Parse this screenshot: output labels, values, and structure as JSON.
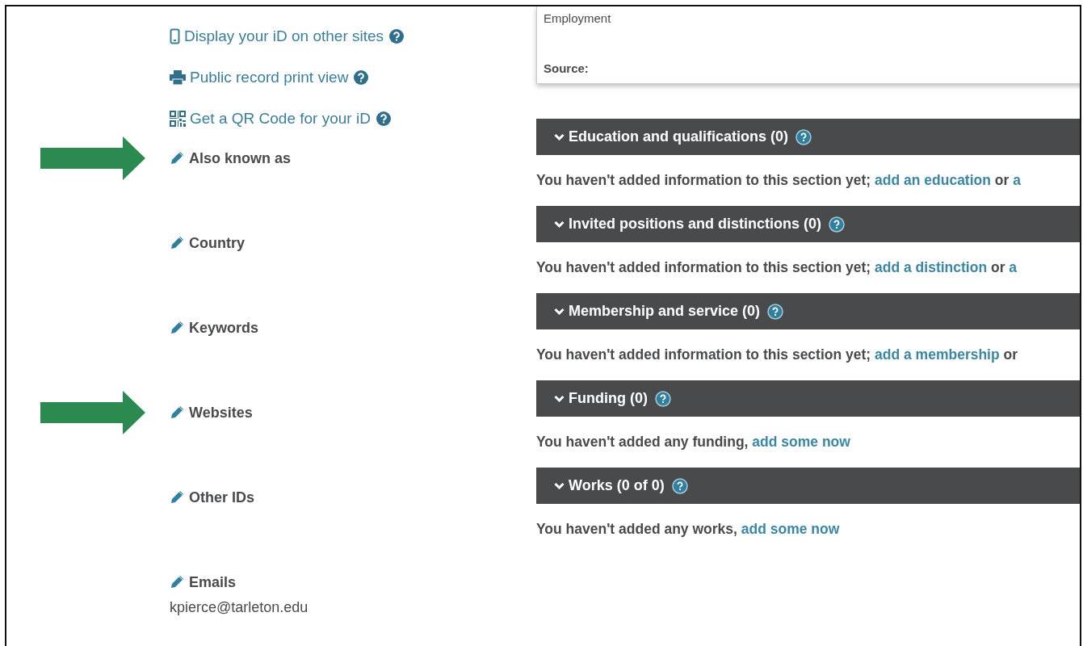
{
  "left_links": [
    {
      "label": "Display your iD on other sites",
      "kind": "phone"
    },
    {
      "label": "Public record print view",
      "kind": "printer"
    },
    {
      "label": "Get a QR Code for your iD",
      "kind": "qr"
    }
  ],
  "bio_items": [
    {
      "label": "Also known as",
      "highlighted": true
    },
    {
      "label": "Country",
      "highlighted": false
    },
    {
      "label": "Keywords",
      "highlighted": false
    },
    {
      "label": "Websites",
      "highlighted": true
    },
    {
      "label": "Other IDs",
      "highlighted": false
    },
    {
      "label": "Emails",
      "highlighted": false,
      "value": "kpierce@tarleton.edu"
    }
  ],
  "employment_card": {
    "title": "Employment",
    "source_label": "Source:"
  },
  "sections": [
    {
      "title": "Education and qualifications (0)",
      "message": [
        {
          "text": "You haven't added information to this section yet;",
          "kind": "plain"
        },
        {
          "text": "add an education",
          "kind": "link"
        },
        {
          "text": "or",
          "kind": "plain"
        },
        {
          "text": "a",
          "kind": "link"
        }
      ]
    },
    {
      "title": "Invited positions and distinctions (0)",
      "message": [
        {
          "text": "You haven't added information to this section yet;",
          "kind": "plain"
        },
        {
          "text": "add a distinction",
          "kind": "link"
        },
        {
          "text": "or",
          "kind": "plain"
        },
        {
          "text": "a",
          "kind": "link"
        }
      ]
    },
    {
      "title": "Membership and service (0)",
      "message": [
        {
          "text": "You haven't added information to this section yet;",
          "kind": "plain"
        },
        {
          "text": "add a membership",
          "kind": "link"
        },
        {
          "text": "or",
          "kind": "plain"
        }
      ]
    },
    {
      "title": "Funding (0)",
      "message": [
        {
          "text": "You haven't added any funding,",
          "kind": "plain"
        },
        {
          "text": "add some now",
          "kind": "link"
        }
      ]
    },
    {
      "title": "Works (0 of 0)",
      "message": [
        {
          "text": "You haven't added any works,",
          "kind": "plain"
        },
        {
          "text": "add some now",
          "kind": "link"
        }
      ]
    }
  ]
}
